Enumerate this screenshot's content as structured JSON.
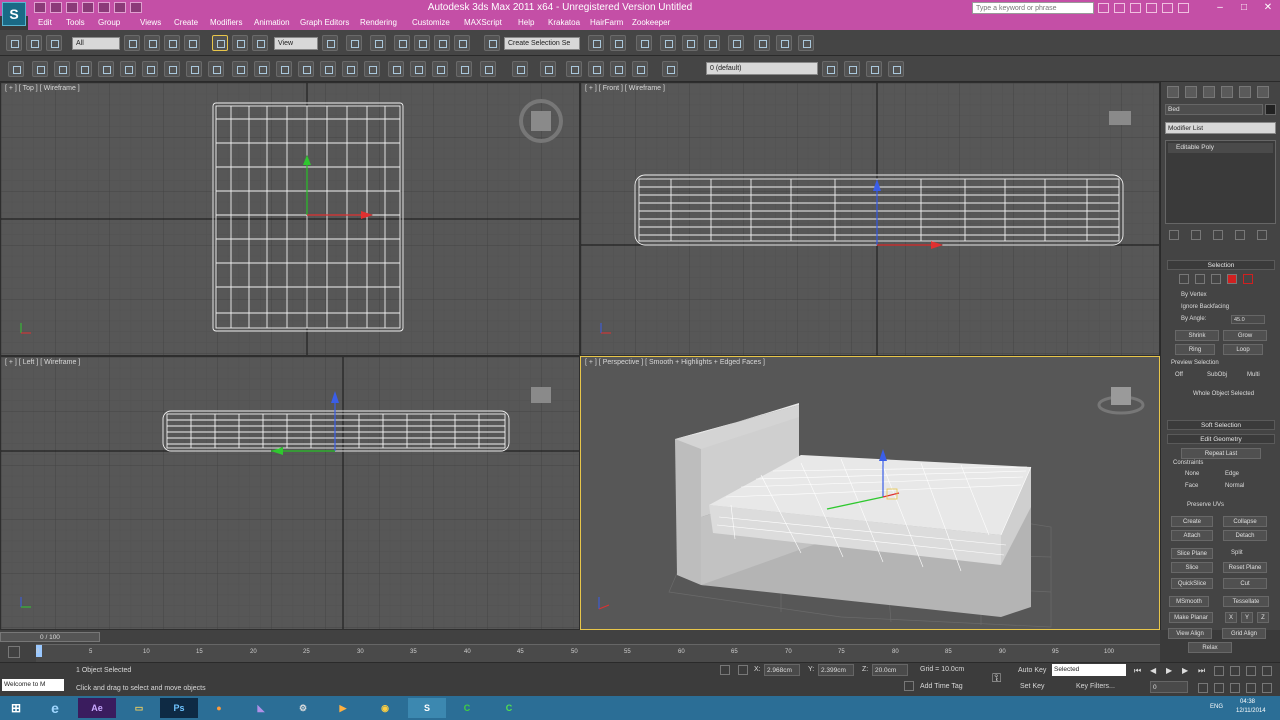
{
  "window": {
    "title": "Autodesk 3ds Max  2011 x64  - Unregistered Version   Untitled",
    "search_placeholder": "Type a keyword or phrase",
    "accent": "#c44fa6"
  },
  "menu": [
    "Edit",
    "Tools",
    "Group",
    "Views",
    "Create",
    "Modifiers",
    "Animation",
    "Graph Editors",
    "Rendering",
    "Customize",
    "MAXScript",
    "Help",
    "Krakatoa",
    "HairFarm",
    "Zookeeper"
  ],
  "main_toolbar": {
    "selection_filter": "All",
    "reference_coord": "View",
    "named_selection": "Create Selection Se"
  },
  "layer_toolbar": {
    "layer": "0 (default)"
  },
  "viewports": {
    "top": {
      "label": "[ + ] [ Top ] [ Wireframe ]"
    },
    "front": {
      "label": "[ + ] [ Front ] [ Wireframe ]"
    },
    "left": {
      "label": "[ + ] [ Left ] [ Wireframe ]"
    },
    "perspective": {
      "label": "[ + ] [ Perspective ] [ Smooth + Highlights + Edged Faces ]"
    }
  },
  "command_panel": {
    "object_name": "Bed",
    "modifier_list": "Modifier List",
    "stack_item": "Editable Poly",
    "selection": {
      "header": "Selection",
      "by_vertex": "By Vertex",
      "ignore_backfacing": "Ignore Backfacing",
      "by_angle": "By Angle:",
      "by_angle_value": "45.0",
      "shrink": "Shrink",
      "grow": "Grow",
      "ring": "Ring",
      "loop": "Loop",
      "preview_selection": "Preview Selection",
      "preview_off": "Off",
      "preview_subobj": "SubObj",
      "preview_multi": "Multi",
      "status": "Whole Object Selected"
    },
    "soft_selection": {
      "header": "Soft Selection"
    },
    "edit_geometry": {
      "header": "Edit Geometry",
      "repeat_last": "Repeat Last",
      "constraints": "Constraints",
      "c_none": "None",
      "c_edge": "Edge",
      "c_face": "Face",
      "c_normal": "Normal",
      "preserve_uvs": "Preserve UVs",
      "create": "Create",
      "collapse": "Collapse",
      "attach": "Attach",
      "detach": "Detach",
      "slice_plane": "Slice Plane",
      "split": "Split",
      "slice": "Slice",
      "reset_plane": "Reset Plane",
      "quickslice": "QuickSlice",
      "cut": "Cut",
      "msmooth": "MSmooth",
      "tessellate": "Tessellate",
      "make_planar": "Make Planar",
      "x": "X",
      "y": "Y",
      "z": "Z",
      "view_align": "View Align",
      "grid_align": "Grid Align",
      "relax": "Relax"
    }
  },
  "timeline": {
    "frame_indicator": "0 / 100",
    "ticks": [
      "0",
      "5",
      "10",
      "15",
      "20",
      "25",
      "30",
      "35",
      "40",
      "45",
      "50",
      "55",
      "60",
      "65",
      "70",
      "75",
      "80",
      "85",
      "90",
      "95",
      "100"
    ]
  },
  "status": {
    "maxscript": "Welcome to M",
    "selected": "1 Object Selected",
    "prompt": "Click and drag to select and move objects",
    "x_label": "X:",
    "x": "2.968cm",
    "y_label": "Y:",
    "y": "2.399cm",
    "z_label": "Z:",
    "z": "20.0cm",
    "grid": "Grid = 10.0cm",
    "auto_key": "Auto Key",
    "set_key": "Set Key",
    "key_mode": "Selected",
    "key_filters": "Key Filters...",
    "add_time_tag": "Add Time Tag",
    "frame": "0"
  },
  "taskbar": {
    "apps": [
      "ie-icon",
      "after-effects-icon",
      "explorer-icon",
      "photoshop-icon",
      "firefox-icon",
      "visual-studio-icon",
      "settings-icon",
      "media-player-icon",
      "chrome-icon",
      "3dsmax-icon",
      "camtasia-icon",
      "camtasia-recorder-icon"
    ],
    "ae": "Ae",
    "ps": "Ps",
    "lang": "ENG",
    "time": "04:38",
    "date": "12/11/2014"
  }
}
